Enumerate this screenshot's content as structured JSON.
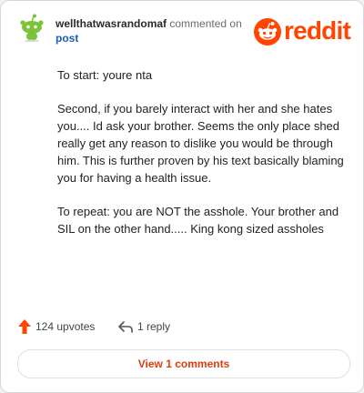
{
  "header": {
    "username": "wellthatwasrandomaf",
    "action_text": "commented",
    "on_text": "on",
    "post_link": "post"
  },
  "logo": {
    "text": "reddit",
    "brand_color": "#ff4500"
  },
  "comment": {
    "paragraphs": [
      "To start: youre nta",
      "Second, if you barely interact with her and she hates you.... Id ask your brother. Seems the only place shed really get any reason to dislike you would be through him. This is further proven by his text basically blaming you for having a health issue.",
      "To repeat: you are NOT the asshole. Your brother and SIL on the other hand..... King kong sized assholes"
    ]
  },
  "actions": {
    "upvotes": "124 upvotes",
    "replies": "1 reply"
  },
  "view_comments_label": "View 1 comments",
  "icons": {
    "avatar": "snoo-avatar-icon",
    "logo": "reddit-logo-icon",
    "upvote": "upvote-arrow-icon",
    "reply": "reply-arrow-icon"
  },
  "colors": {
    "accent": "#ff4500",
    "upvote": "#ff4500",
    "link": "#1a5fb4",
    "avatar_green": "#7bc43a"
  }
}
